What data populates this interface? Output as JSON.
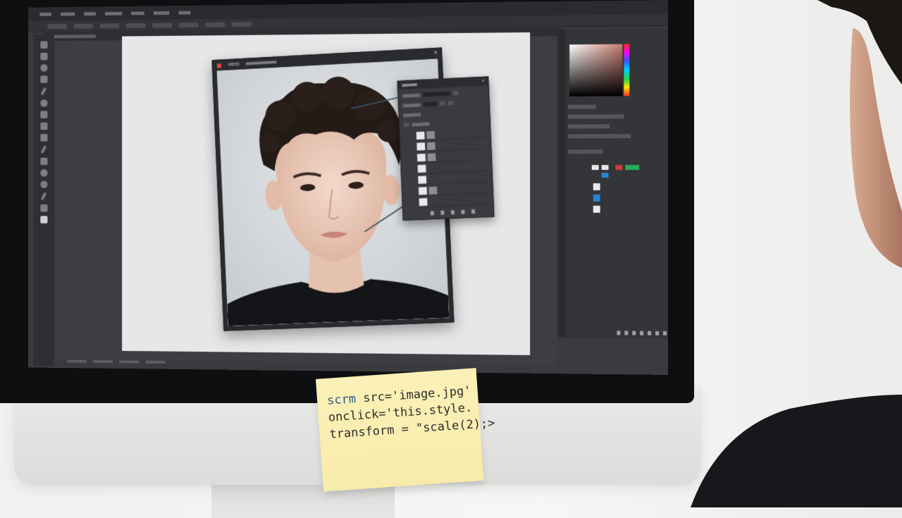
{
  "app": {
    "title": "Image editor on monitor",
    "photo_window": {
      "title": "Html"
    },
    "tabs": [],
    "menu": []
  },
  "sticky_note": {
    "line1_keyword": "scrm",
    "line1_rest": " src='image.jpg'",
    "line2": "onclick='this.style.",
    "line3": "transform = \"scale(2);>"
  },
  "colors": {
    "accent_blue": "#2a82d6",
    "swatch_red": "#d23b3b",
    "swatch_green": "#22b05a",
    "note_yellow": "#fbf1b8"
  },
  "icons": [
    "move-tool-icon",
    "marquee-tool-icon",
    "lasso-tool-icon",
    "crop-tool-icon",
    "eyedropper-tool-icon",
    "brush-tool-icon",
    "stamp-tool-icon",
    "eraser-tool-icon",
    "gradient-tool-icon",
    "pen-tool-icon",
    "text-tool-icon",
    "hand-tool-icon",
    "zoom-tool-icon"
  ]
}
